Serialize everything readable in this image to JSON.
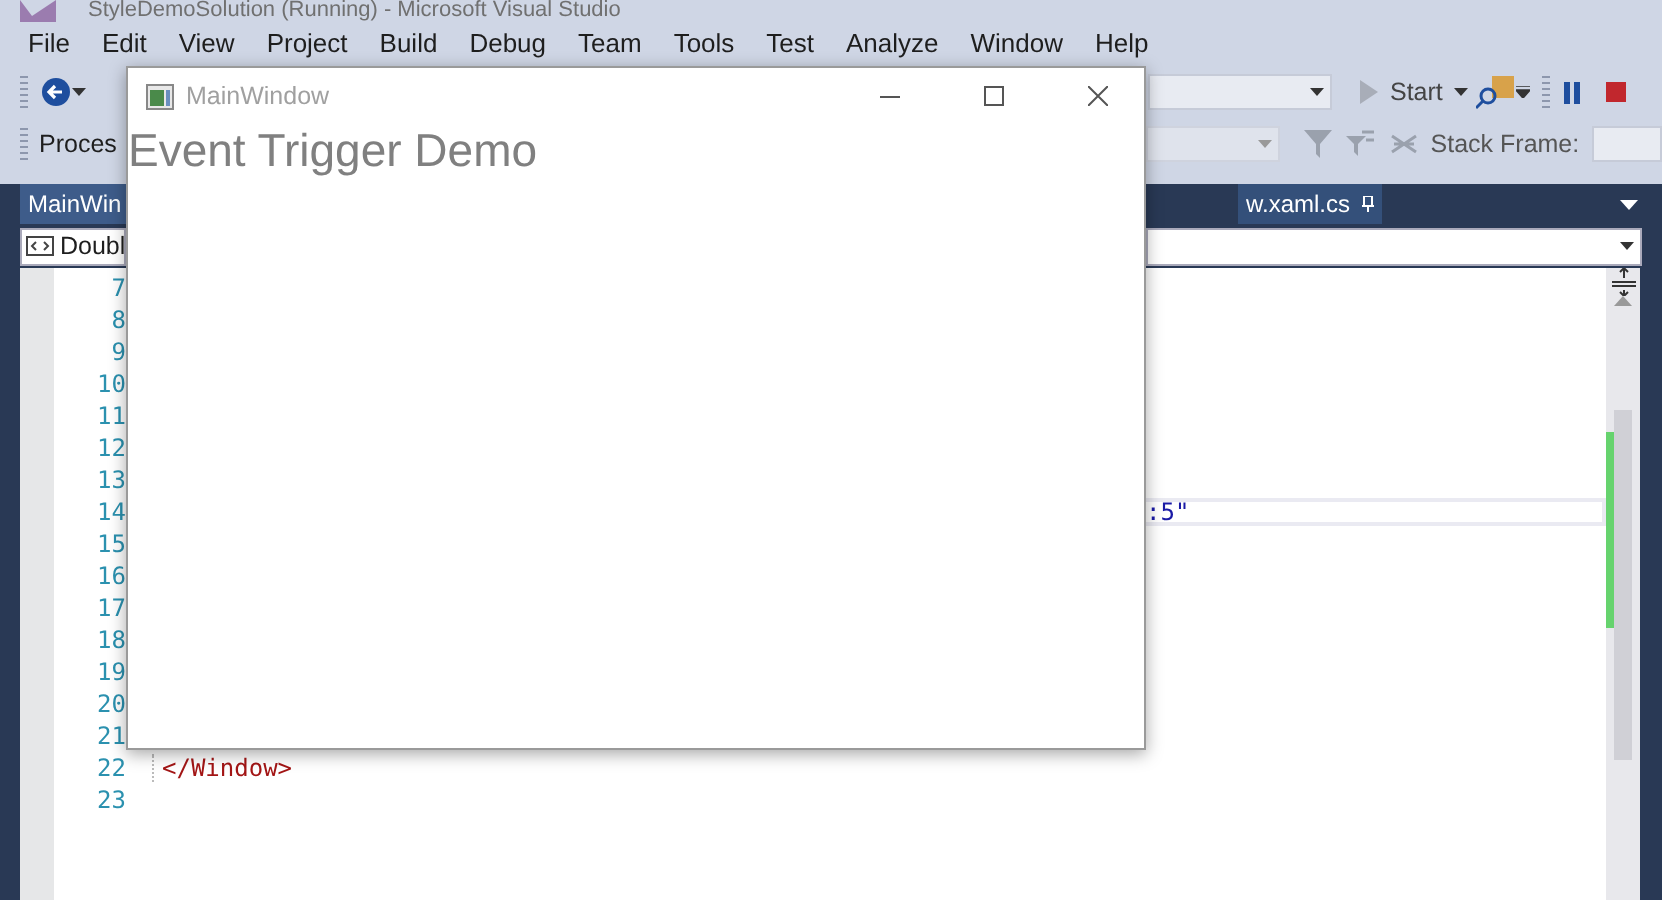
{
  "ide": {
    "title": "StyleDemoSolution (Running) - Microsoft Visual Studio",
    "menu": [
      "File",
      "Edit",
      "View",
      "Project",
      "Build",
      "Debug",
      "Team",
      "Tools",
      "Test",
      "Analyze",
      "Window",
      "Help"
    ],
    "toolbar": {
      "start_label": "Start",
      "process_label": "Proces",
      "stack_frame_label": "Stack Frame:"
    },
    "doc_tabs": [
      {
        "label": "MainWin",
        "selected": true
      },
      {
        "label": "w.xaml.cs",
        "selected": false,
        "pinned": true
      }
    ],
    "nav_bar": {
      "member": "Doubl"
    },
    "editor": {
      "lines": [
        {
          "number": "7",
          "current": false
        },
        {
          "number": "8",
          "current": false
        },
        {
          "number": "9",
          "current": false
        },
        {
          "number": "10",
          "current": false
        },
        {
          "number": "11",
          "current": false
        },
        {
          "number": "12",
          "current": false
        },
        {
          "number": "13",
          "current": false
        },
        {
          "number": "14",
          "code": ":5\"",
          "current": true
        },
        {
          "number": "15",
          "current": false
        },
        {
          "number": "16",
          "current": false
        },
        {
          "number": "17",
          "current": false
        },
        {
          "number": "18",
          "current": false
        },
        {
          "number": "19",
          "current": false
        },
        {
          "number": "20",
          "current": false
        },
        {
          "number": "21",
          "current": false
        },
        {
          "number": "22",
          "code": "</Window>",
          "current": false
        },
        {
          "number": "23",
          "current": false
        }
      ]
    }
  },
  "app_window": {
    "title": "MainWindow",
    "heading": "Event Trigger Demo"
  }
}
